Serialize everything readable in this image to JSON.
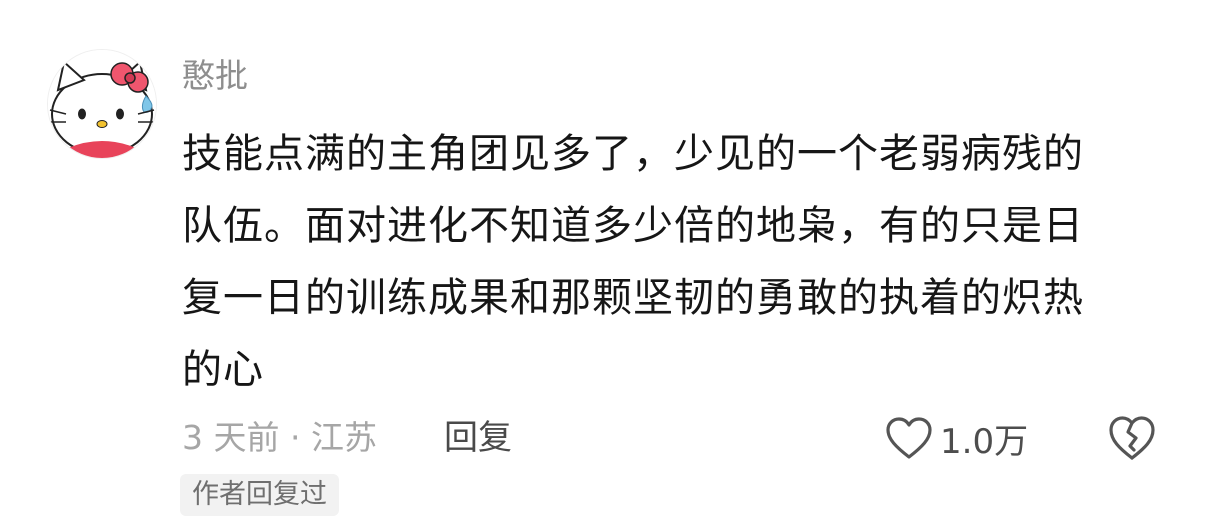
{
  "comment": {
    "username": "憨批",
    "content_lines": [
      "技能点满的主角团见多了，少见的一个老弱病残的",
      "队伍。面对进化不知道多少倍的地枭，有的只是日",
      "复一日的训练成果和那颗坚韧的勇敢的执着的炽热",
      "的心"
    ],
    "meta": "3 天前 · 江苏",
    "reply_label": "回复",
    "like_count": "1.0万",
    "author_replied_badge": "作者回复过",
    "avatar_icon": "hello-kitty-avatar",
    "like_icon": "heart-outline-icon",
    "dislike_icon": "broken-heart-icon"
  }
}
